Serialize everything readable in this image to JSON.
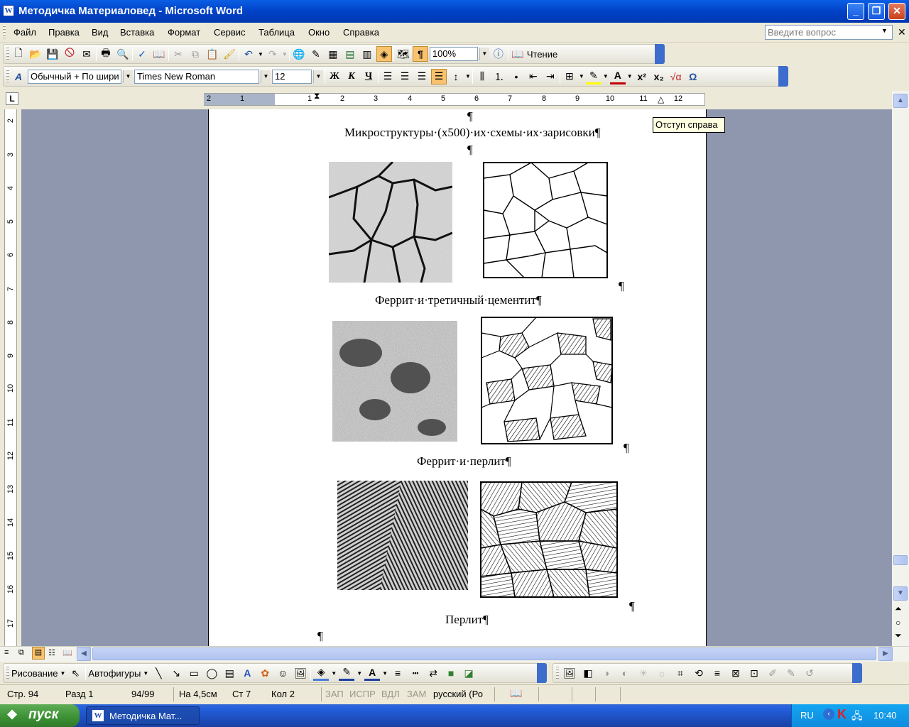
{
  "window": {
    "title": "Методичка Материаловед - Microsoft Word",
    "app_icon": "W"
  },
  "menu": {
    "items": [
      "Файл",
      "Правка",
      "Вид",
      "Вставка",
      "Формат",
      "Сервис",
      "Таблица",
      "Окно",
      "Справка"
    ],
    "ask_placeholder": "Введите вопрос"
  },
  "toolbar_standard": {
    "zoom": "100%",
    "reading_label": "Чтение"
  },
  "toolbar_format": {
    "style": "Обычный + По шири",
    "font": "Times New Roman",
    "size": "12",
    "bold": "Ж",
    "italic": "К",
    "underline": "Ч"
  },
  "ruler": {
    "tab_selector": "L",
    "h_ticks": [
      "2",
      "1",
      "1",
      "2",
      "3",
      "4",
      "5",
      "6",
      "7",
      "8",
      "9",
      "10",
      "11",
      "12"
    ],
    "v_ticks": [
      "2",
      "3",
      "4",
      "5",
      "6",
      "7",
      "8",
      "9",
      "10",
      "11",
      "12",
      "13",
      "14",
      "15",
      "16",
      "17"
    ]
  },
  "tooltip": "Отступ справа",
  "document": {
    "pilcrow": "¶",
    "heading": "Микроструктуры·(х500)·их·схемы·их·зарисовки¶",
    "caption1": "Феррит·и·третичный·цементит¶",
    "caption2": "Феррит·и·перлит¶",
    "caption3": "Перлит¶"
  },
  "drawing_toolbar": {
    "draw_label": "Рисование",
    "autoshapes_label": "Автофигуры"
  },
  "status": {
    "page": "Стр. 94",
    "section": "Разд  1",
    "pages": "94/99",
    "at": "На 4,5см",
    "line": "Ст  7",
    "col": "Кол  2",
    "rec": "ЗАП",
    "trk": "ИСПР",
    "ext": "ВДЛ",
    "ovr": "ЗАМ",
    "lang": "русский (Ро"
  },
  "taskbar": {
    "start": "пуск",
    "task_item": "Методичка Мат...",
    "lang": "RU",
    "clock": "10:40"
  },
  "colors": {
    "titlebar": "#0A5FE4",
    "chrome": "#ECE9D8",
    "doc_background": "#8F97AE",
    "taskbar": "#245EDC",
    "start_button": "#3C8F33"
  }
}
